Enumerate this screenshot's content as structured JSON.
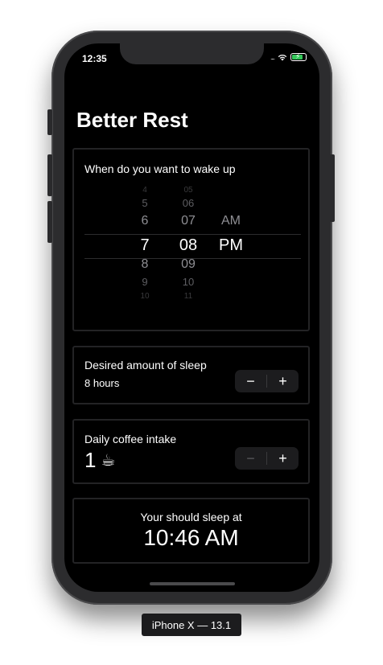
{
  "status_bar": {
    "time": "12:35",
    "signal_dots": "....",
    "wifi_icon": "wifi-icon",
    "battery_icon": "battery-charging-icon",
    "battery_color": "#34c759"
  },
  "app": {
    "title": "Better Rest"
  },
  "wake_section": {
    "label": "When do you want to wake up",
    "hours": [
      "4",
      "5",
      "6",
      "7",
      "8",
      "9",
      "10"
    ],
    "minutes": [
      "05",
      "06",
      "07",
      "08",
      "09",
      "10",
      "11"
    ],
    "ampm": [
      "AM",
      "PM"
    ],
    "selected_hour": "7",
    "selected_minute": "08",
    "selected_ampm": "PM"
  },
  "sleep_section": {
    "label": "Desired amount of sleep",
    "value": "8 hours",
    "minus": "−",
    "plus": "+"
  },
  "coffee_section": {
    "label": "Daily coffee intake",
    "value": "1",
    "icon": "☕",
    "minus": "−",
    "plus": "+"
  },
  "result_section": {
    "label": "Your should sleep at",
    "time": "10:46 AM"
  },
  "device_label": "iPhone X — 13.1"
}
